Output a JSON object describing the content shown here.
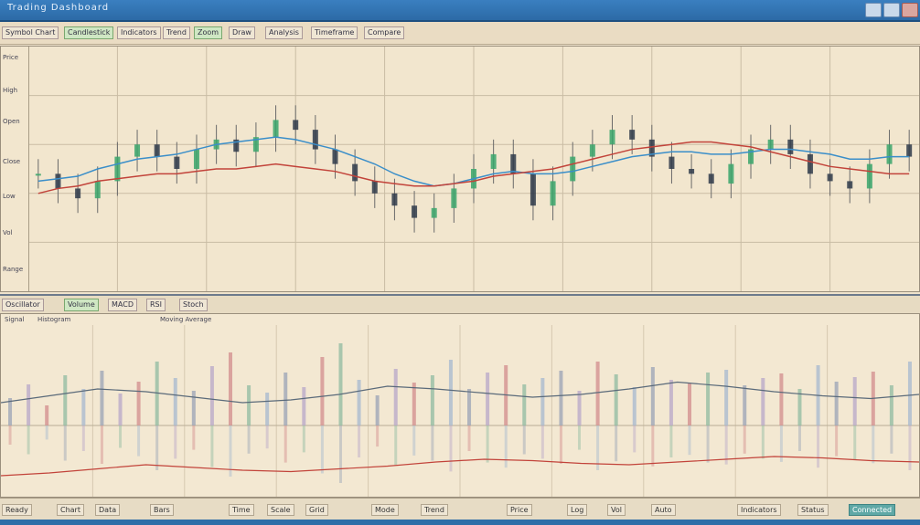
{
  "window": {
    "title": "Trading Dashboard"
  },
  "toolbar": {
    "buttons": [
      {
        "label": "Symbol Chart"
      },
      {
        "label": "Candlestick"
      },
      {
        "label": "Indicators"
      },
      {
        "label": "Trend"
      },
      {
        "label": "Zoom"
      },
      {
        "label": "Draw"
      },
      {
        "label": "Analysis"
      },
      {
        "label": "Timeframe"
      },
      {
        "label": "Compare"
      }
    ]
  },
  "sidebar": {
    "labels": [
      "Price",
      "High",
      "Open",
      "Close",
      "Low",
      "Vol",
      "Range"
    ]
  },
  "indicator_toolbar": {
    "buttons": [
      "Oscillator",
      "Volume",
      "MACD",
      "RSI",
      "Stoch"
    ]
  },
  "indicator_labels": [
    "Signal",
    "Histogram",
    "Moving Average"
  ],
  "statusbar": {
    "items": [
      "Ready",
      "Chart",
      "Data",
      "Bars",
      "Time",
      "Scale",
      "Grid",
      "Mode",
      "Trend",
      "Price",
      "Log",
      "Vol",
      "Auto",
      "Indicators",
      "Status",
      "Connected"
    ]
  },
  "colors": {
    "accent": "#2c6aa6",
    "bullish": "#3aa56b",
    "bearish": "#2f3a4a",
    "trendline": "#c2433a",
    "ma_line": "#3a8ec9"
  },
  "chart_data": [
    {
      "type": "line",
      "title": "",
      "series": [
        {
          "values": [
            48,
            42,
            38,
            45,
            55,
            60,
            55,
            50,
            58,
            62,
            57,
            63,
            70,
            66,
            58,
            52,
            45,
            40,
            35,
            30,
            34,
            42,
            50,
            56,
            48,
            35,
            45,
            55,
            60,
            66,
            62,
            55,
            50,
            48,
            44,
            52,
            58,
            62,
            56,
            48,
            45,
            42,
            52,
            60,
            55
          ]
        },
        {
          "values": [
            45,
            46,
            47,
            50,
            52,
            54,
            55,
            56,
            58,
            60,
            61,
            62,
            63,
            62,
            60,
            58,
            55,
            52,
            48,
            45,
            43,
            44,
            46,
            48,
            49,
            48,
            48,
            49,
            51,
            53,
            55,
            56,
            57,
            57,
            56,
            56,
            57,
            58,
            58,
            57,
            56,
            54,
            54,
            55,
            55
          ]
        },
        {
          "values": [
            40,
            42,
            43,
            45,
            46,
            47,
            48,
            48,
            49,
            50,
            50,
            51,
            52,
            51,
            50,
            49,
            47,
            45,
            44,
            43,
            43,
            44,
            45,
            47,
            48,
            49,
            50,
            52,
            54,
            56,
            58,
            59,
            60,
            61,
            61,
            60,
            59,
            57,
            55,
            53,
            51,
            50,
            49,
            48,
            48
          ]
        }
      ],
      "grid": true
    },
    {
      "type": "bar",
      "title": "",
      "values": [
        30,
        45,
        22,
        55,
        40,
        60,
        35,
        48,
        70,
        52,
        38,
        65,
        80,
        44,
        36,
        58,
        42,
        75,
        90,
        50,
        33,
        62,
        47,
        55,
        72,
        40,
        58,
        66,
        45,
        52,
        60,
        38,
        70,
        56,
        42,
        64,
        50,
        46,
        58,
        61,
        44,
        52,
        57,
        40,
        66,
        48,
        53,
        59,
        44,
        70
      ],
      "series": [
        {
          "values": [
            40,
            45,
            50,
            48,
            44,
            40,
            42,
            46,
            52,
            50,
            47,
            44,
            46,
            50,
            55,
            52,
            48,
            45,
            43,
            46
          ]
        },
        {
          "values": [
            30,
            32,
            35,
            38,
            36,
            34,
            33,
            35,
            37,
            40,
            42,
            41,
            39,
            38,
            40,
            42,
            44,
            43,
            41,
            40
          ]
        }
      ],
      "grid": true
    }
  ]
}
